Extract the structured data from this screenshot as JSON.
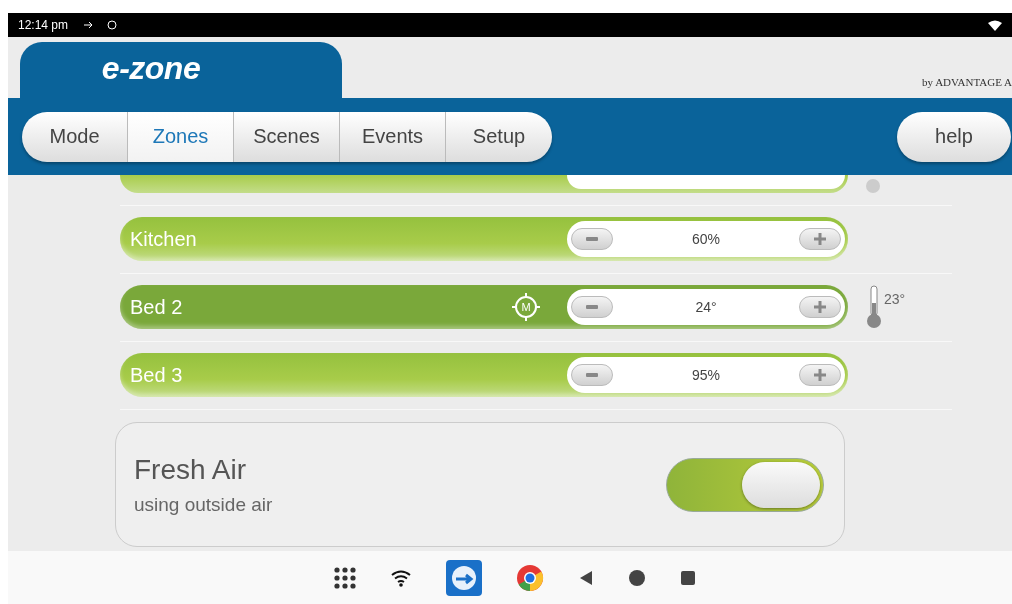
{
  "status_bar": {
    "time": "12:14 pm"
  },
  "header": {
    "logo": "e-zone",
    "brand": "by ADVANTAGE A"
  },
  "tabs": [
    {
      "label": "Mode",
      "selected": false
    },
    {
      "label": "Zones",
      "selected": true
    },
    {
      "label": "Scenes",
      "selected": false
    },
    {
      "label": "Events",
      "selected": false
    },
    {
      "label": "Setup",
      "selected": false
    }
  ],
  "help_button": "help",
  "zones": [
    {
      "name": "Kitchen",
      "value": "60%",
      "selected": false
    },
    {
      "name": "Bed 2",
      "value": "24°",
      "selected": true,
      "badge": "M",
      "temperature": "23°"
    },
    {
      "name": "Bed 3",
      "value": "95%",
      "selected": false
    }
  ],
  "fresh_air": {
    "title": "Fresh Air",
    "subtitle": "using outside air",
    "on": true
  }
}
